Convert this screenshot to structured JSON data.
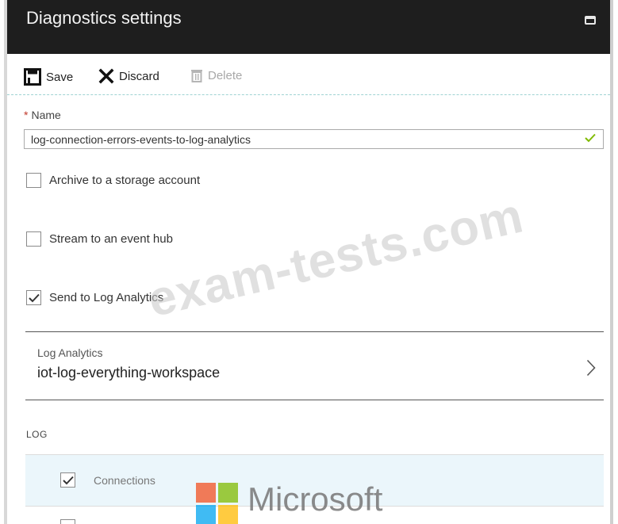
{
  "header": {
    "title": "Diagnostics settings",
    "maximize_icon": "maximize-icon"
  },
  "toolbar": {
    "save_label": "Save",
    "discard_label": "Discard",
    "delete_label": "Delete",
    "save_icon": "save-icon",
    "discard_icon": "close-icon",
    "delete_icon": "trash-icon"
  },
  "form": {
    "name_label": "Name",
    "name_required_marker": "*",
    "name_value": "log-connection-errors-events-to-log-analytics",
    "name_valid": true,
    "archive_label": "Archive to a storage account",
    "archive_checked": false,
    "stream_label": "Stream to an event hub",
    "stream_checked": false,
    "send_label": "Send to Log Analytics",
    "send_checked": true
  },
  "log_analytics": {
    "label": "Log Analytics",
    "value": "iot-log-everything-workspace"
  },
  "log_section": {
    "header": "LOG",
    "items": [
      {
        "label": "Connections",
        "checked": true
      }
    ]
  },
  "overlay": {
    "watermark": "exam-tests.com",
    "brand_text": "Microsoft",
    "brand_colors": [
      "#f25022",
      "#7fba00",
      "#00a4ef",
      "#ffb900"
    ]
  },
  "colors": {
    "header_bg": "#1e1e1e",
    "required": "#c0392b",
    "valid_check": "#7fba00",
    "selected_row_bg": "#ebf6fb"
  }
}
